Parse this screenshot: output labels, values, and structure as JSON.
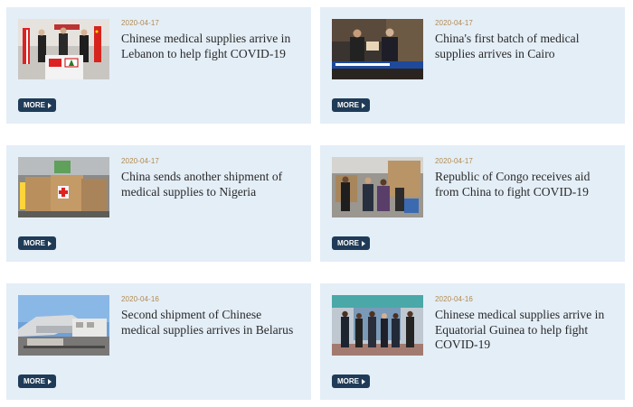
{
  "news": {
    "more_label": "MORE",
    "items": [
      {
        "date": "2020-04-17",
        "title": "Chinese medical supplies arrive in Lebanon to help fight COVID-19"
      },
      {
        "date": "2020-04-17",
        "title": "China's first batch of medical supplies arrives in Cairo"
      },
      {
        "date": "2020-04-17",
        "title": "China sends another shipment of medical supplies to Nigeria"
      },
      {
        "date": "2020-04-17",
        "title": "Republic of Congo receives aid from China to fight COVID-19"
      },
      {
        "date": "2020-04-16",
        "title": "Second shipment of Chinese medical supplies arrives in Belarus"
      },
      {
        "date": "2020-04-16",
        "title": "Chinese medical supplies arrive in Equatorial Guinea to help fight COVID-19"
      }
    ]
  }
}
